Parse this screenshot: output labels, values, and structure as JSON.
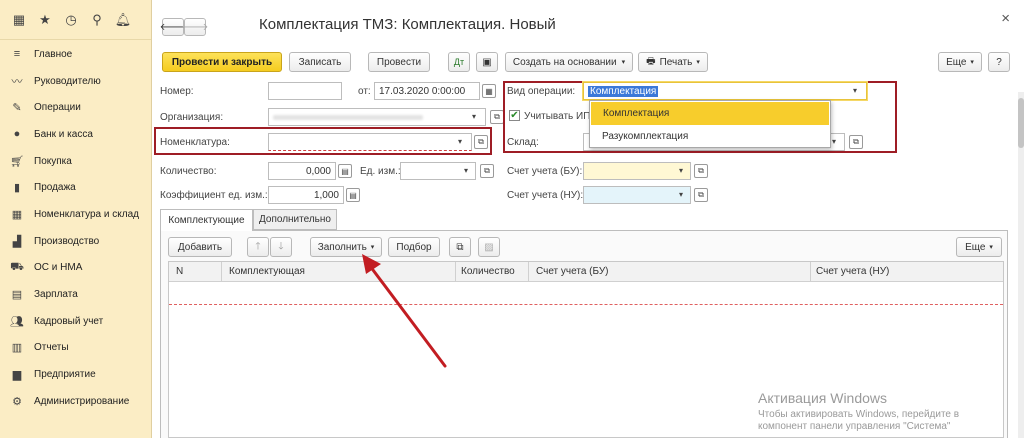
{
  "nav": {
    "items": [
      "Главное",
      "Руководителю",
      "Операции",
      "Банк и касса",
      "Покупка",
      "Продажа",
      "Номенклатура и склад",
      "Производство",
      "ОС и НМА",
      "Зарплата",
      "Кадровый учет",
      "Отчеты",
      "Предприятие",
      "Администрирование"
    ]
  },
  "header": {
    "title": "Комплектация ТМЗ: Комплектация. Новый",
    "close": "×"
  },
  "toolbar": {
    "post_close": "Провести и закрыть",
    "save": "Записать",
    "post": "Провести",
    "create_based": "Создать на основании",
    "print": "Печать",
    "more": "Еще",
    "help": "?"
  },
  "form": {
    "number_label": "Номер:",
    "number_value": "",
    "date_label": "от:",
    "date_value": "17.03.2020  0:00:00",
    "org_label": "Организация:",
    "nomen_label": "Номенклатура:",
    "nomen_value": "",
    "qty_label": "Количество:",
    "qty_value": "0,000",
    "unit_label": "Ед. изм.:",
    "unit_value": "",
    "coef_label": "Коэффициент ед. изм.:",
    "coef_value": "1,000",
    "optype_label": "Вид операции:",
    "optype_value": "Комплектация",
    "vat_label": "Учитывать ИП",
    "warehouse_label": "Склад:",
    "acct_bu_label": "Счет учета (БУ):",
    "acct_nu_label": "Счет учета (НУ):"
  },
  "dropdown": {
    "options": [
      "Комплектация",
      "Разукомплектация"
    ],
    "selected": "Комплектация"
  },
  "tabs": [
    {
      "label": "Комплектующие"
    },
    {
      "label": "Дополнительно"
    }
  ],
  "table_toolbar": {
    "add": "Добавить",
    "fill": "Заполнить",
    "pick": "Подбор",
    "more": "Еще"
  },
  "table": {
    "columns": [
      "N",
      "Комплектующая",
      "Количество",
      "Счет учета (БУ)",
      "Счет учета (НУ)"
    ]
  },
  "watermark": {
    "line1": "Активация Windows",
    "line2": "Чтобы активировать Windows, перейдите в",
    "line3": "компонент панели управления \"Система\""
  }
}
